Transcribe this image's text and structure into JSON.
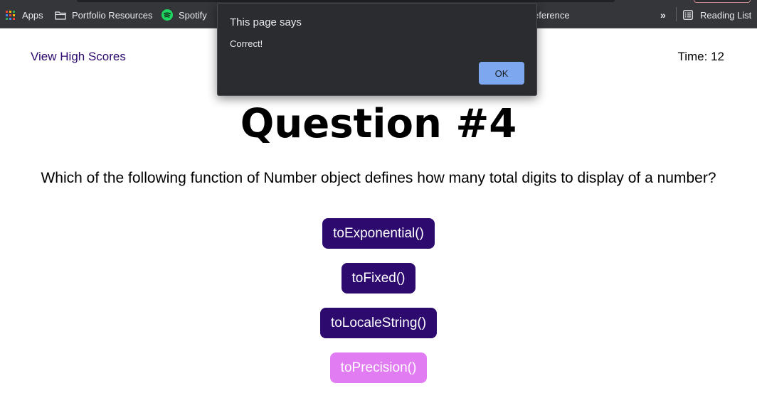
{
  "browser": {
    "bookmarks": {
      "apps": "Apps",
      "portfolio": "Portfolio Resources",
      "spotify": "Spotify",
      "reference_partial": "eference",
      "more": "»",
      "reading_list": "Reading List"
    },
    "icons": [
      "apps-grid-icon",
      "folder-icon",
      "spotify-icon",
      "more-chevrons-icon",
      "reading-list-icon"
    ]
  },
  "header": {
    "high_scores": "View High Scores",
    "timer": "Time: 12"
  },
  "quiz": {
    "title": "Question #4",
    "question": "Which of the following function of Number object defines how many total digits to display of a number?",
    "answers": [
      {
        "label": "toExponential()"
      },
      {
        "label": "toFixed()"
      },
      {
        "label": "toLocaleString()"
      },
      {
        "label": "toPrecision()"
      }
    ],
    "selected_index": 3
  },
  "alert": {
    "title": "This page says",
    "message": "Correct!",
    "ok_label": "OK"
  },
  "colors": {
    "accent": "#2d0a6e",
    "selected": "#e27cf2",
    "alert_bg": "#2b2c2f",
    "ok_button": "#7da8f0",
    "spotify_green": "#1ed760"
  }
}
